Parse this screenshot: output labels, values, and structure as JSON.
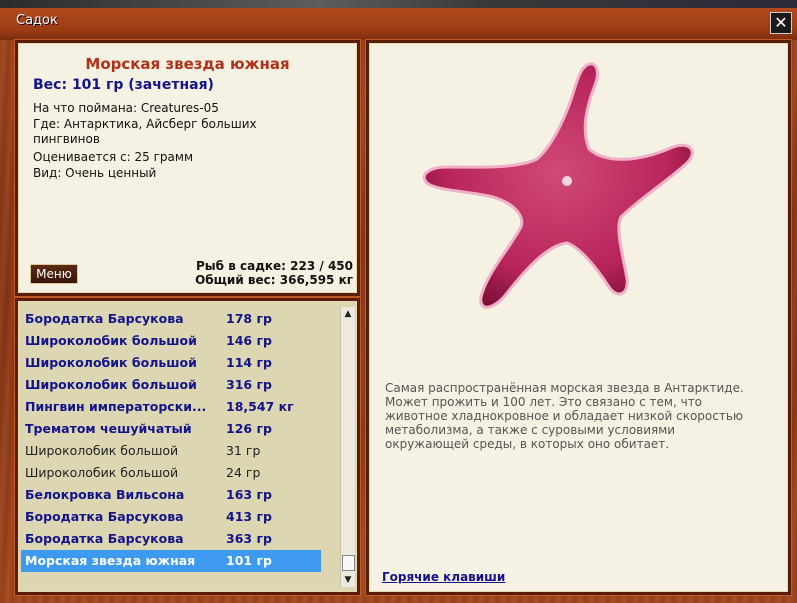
{
  "window": {
    "title": "Садок",
    "close_label": "✕"
  },
  "info": {
    "name": "Морская звезда южная",
    "weight": "Вес: 101 гр (зачетная)",
    "caught_on": "На что поймана: Creatures-05",
    "where": "Где: Антарктика, Айсберг больших пингвинов",
    "evaluated_from": "Оценивается с: 25 грамм",
    "kind": "Вид: Очень ценный",
    "menu_label": "Меню",
    "fish_count": "Рыб в садке: 223 / 450",
    "total_weight": "Общий вес: 366,595 кг"
  },
  "list": {
    "rows": [
      {
        "name": "Бородатка Барсукова",
        "weight": "178 гр",
        "style": "bold"
      },
      {
        "name": "Широколобик большой",
        "weight": "146 гр",
        "style": "bold"
      },
      {
        "name": "Широколобик большой",
        "weight": "114 гр",
        "style": "bold"
      },
      {
        "name": "Широколобик большой",
        "weight": "316 гр",
        "style": "bold"
      },
      {
        "name": "Пингвин императорски...",
        "weight": "18,547 кг",
        "style": "bold"
      },
      {
        "name": "Трематом чешуйчатый",
        "weight": "126 гр",
        "style": "bold"
      },
      {
        "name": "Широколобик большой",
        "weight": "31 гр",
        "style": "plain"
      },
      {
        "name": "Широколобик большой",
        "weight": "24 гр",
        "style": "plain"
      },
      {
        "name": "Белокровка Вильсона",
        "weight": "163 гр",
        "style": "bold"
      },
      {
        "name": "Бородатка Барсукова",
        "weight": "413 гр",
        "style": "bold"
      },
      {
        "name": "Бородатка Барсукова",
        "weight": "363 гр",
        "style": "bold"
      },
      {
        "name": "Морская звезда южная",
        "weight": "101 гр",
        "style": "sel"
      }
    ],
    "scroll_up": "▲",
    "scroll_down": "▼"
  },
  "detail": {
    "description": "Самая распространённая морская звезда в Антарктиде. Может прожить и 100 лет. Это связано с тем, что животное хладнокровное и обладает низкой скоростью метаболизма, а также с суровыми условиями окружающей среды, в которых оно обитает.",
    "hotkeys": "Горячие клавиши",
    "colors": {
      "star": "#b8245a",
      "star_edge": "#e89ab8"
    }
  }
}
